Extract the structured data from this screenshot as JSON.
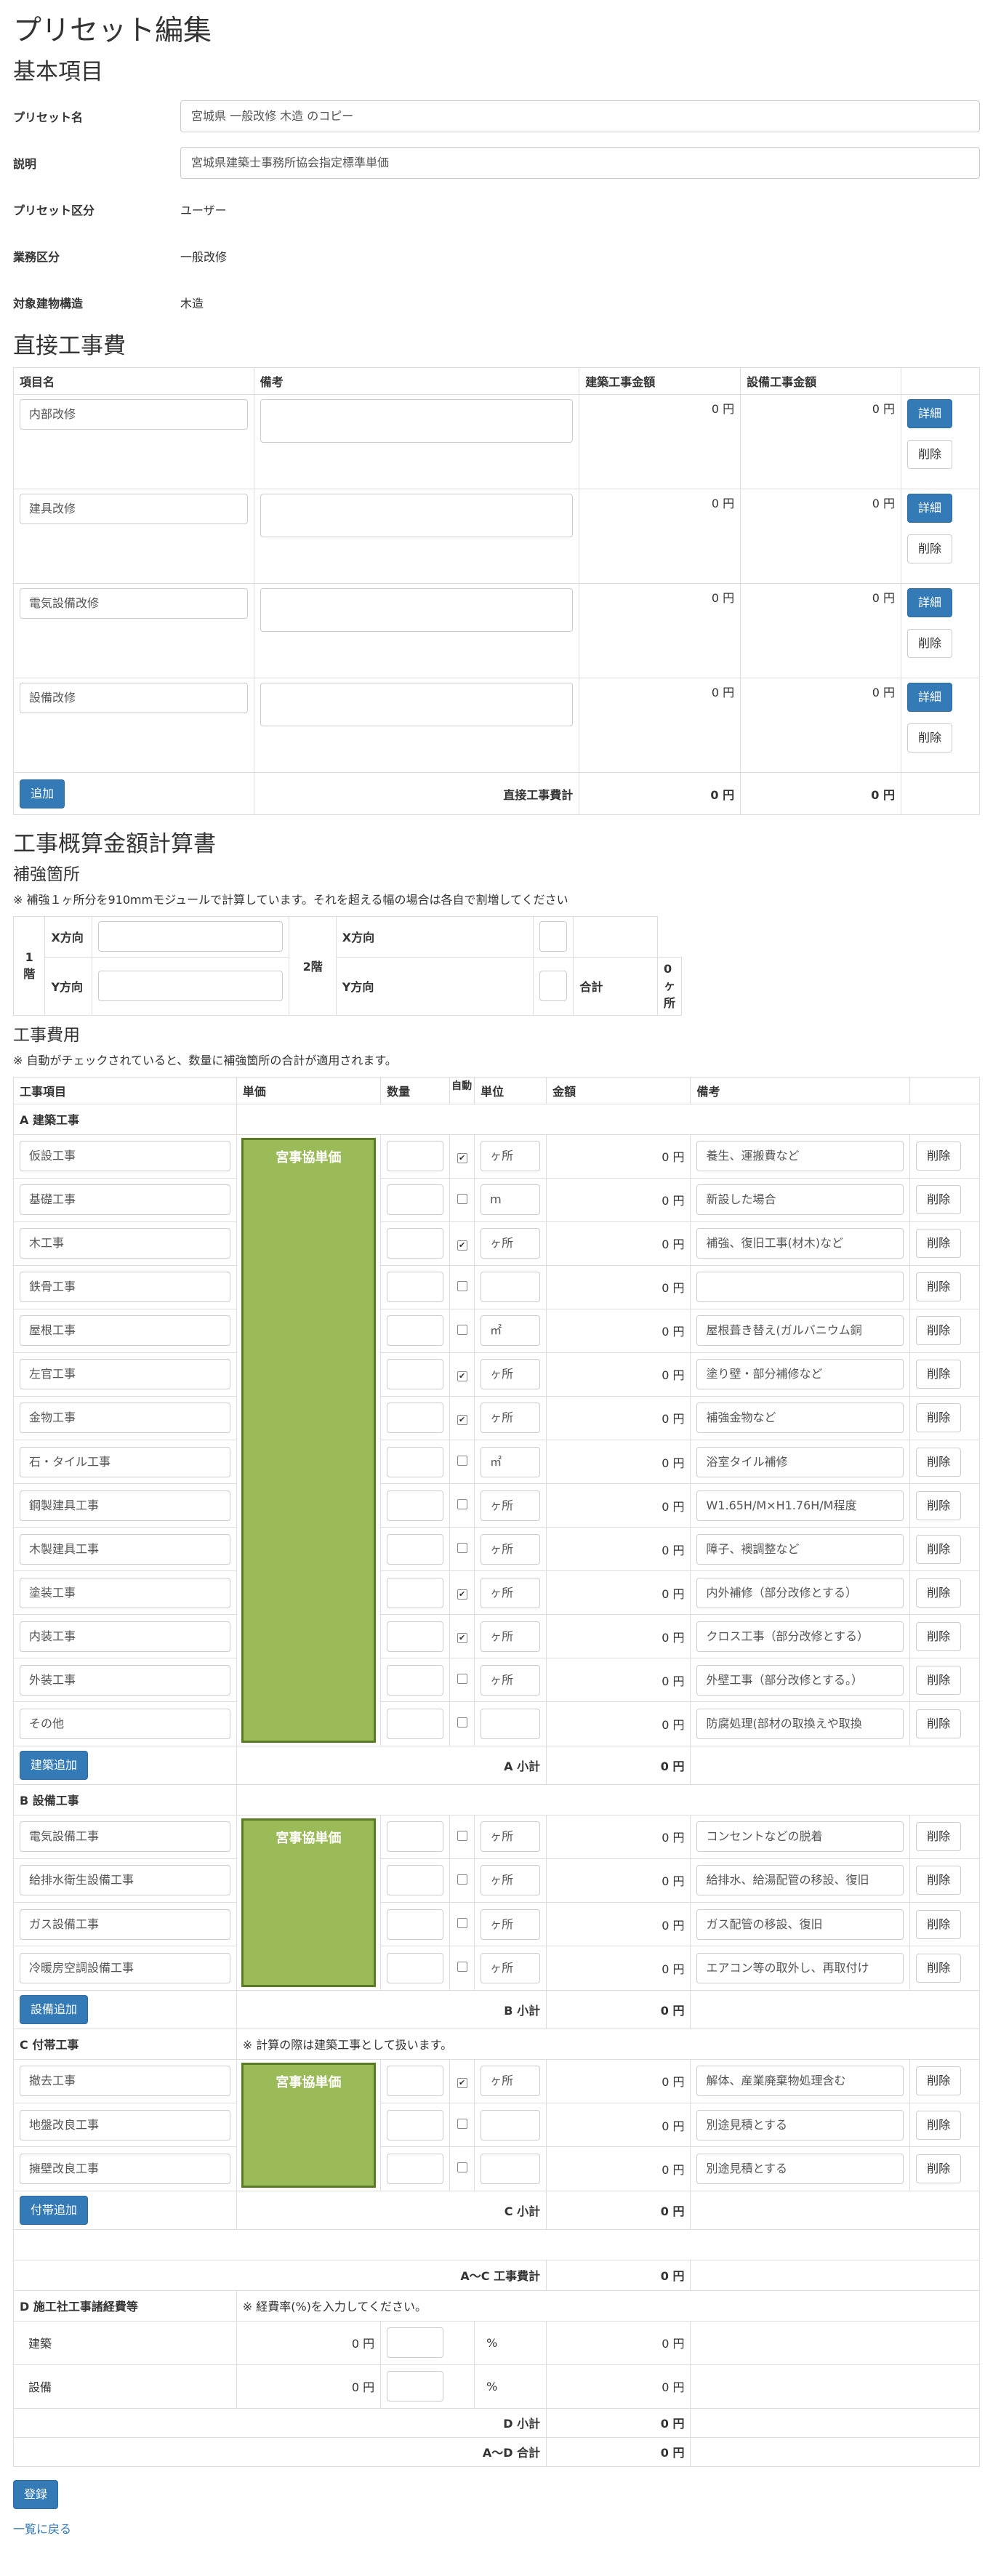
{
  "page_title": "プリセット編集",
  "basic": {
    "heading": "基本項目",
    "preset_name_label": "プリセット名",
    "preset_name_value": "宮城県 一般改修 木造 のコピー",
    "description_label": "説明",
    "description_value": "宮城県建築士事務所協会指定標準単価",
    "preset_class_label": "プリセット区分",
    "preset_class_value": "ユーザー",
    "business_class_label": "業務区分",
    "business_class_value": "一般改修",
    "structure_label": "対象建物構造",
    "structure_value": "木造"
  },
  "direct": {
    "heading": "直接工事費",
    "headers": [
      "項目名",
      "備考",
      "建築工事金額",
      "設備工事金額",
      ""
    ],
    "detail_label": "詳細",
    "delete_label": "削除",
    "rows": [
      {
        "name": "内部改修",
        "arch": "0 円",
        "equip": "0 円"
      },
      {
        "name": "建具改修",
        "arch": "0 円",
        "equip": "0 円"
      },
      {
        "name": "電気設備改修",
        "arch": "0 円",
        "equip": "0 円"
      },
      {
        "name": "設備改修",
        "arch": "0 円",
        "equip": "0 円"
      }
    ],
    "add_label": "追加",
    "total_label": "直接工事費計",
    "total_arch": "0 円",
    "total_equip": "0 円"
  },
  "estimate": {
    "heading": "工事概算金額計算書",
    "reinforce": {
      "heading": "補強箇所",
      "note": "※ 補強１ヶ所分を910mmモジュールで計算しています。それを超える幅の場合は各自で割増してください",
      "floor1": "1階",
      "floor2": "2階",
      "x_dir": "X方向",
      "y_dir": "Y方向",
      "total_label": "合計",
      "total_value": "0 ヶ所"
    },
    "costs": {
      "heading": "工事費用",
      "note": "※ 自動がチェックされていると、数量に補強箇所の合計が適用されます。",
      "headers": {
        "item": "工事項目",
        "unit_price": "単価",
        "qty": "数量",
        "auto": "自動",
        "unit": "単位",
        "amount": "金額",
        "remarks": "備考"
      },
      "price_box_label": "宮事協単価",
      "delete_label": "削除",
      "section_a": {
        "title": "A 建築工事",
        "rows": [
          {
            "name": "仮設工事",
            "auto": true,
            "unit": "ヶ所",
            "amount": "0 円",
            "remark": "養生、運搬費など"
          },
          {
            "name": "基礎工事",
            "auto": false,
            "unit": "m",
            "amount": "0 円",
            "remark": "新設した場合"
          },
          {
            "name": "木工事",
            "auto": true,
            "unit": "ヶ所",
            "amount": "0 円",
            "remark": "補強、復旧工事(材木)など"
          },
          {
            "name": "鉄骨工事",
            "auto": false,
            "unit": "",
            "amount": "0 円",
            "remark": ""
          },
          {
            "name": "屋根工事",
            "auto": false,
            "unit": "㎡",
            "amount": "0 円",
            "remark": "屋根葺き替え(ガルバニウム銅"
          },
          {
            "name": "左官工事",
            "auto": true,
            "unit": "ヶ所",
            "amount": "0 円",
            "remark": "塗り壁・部分補修など"
          },
          {
            "name": "金物工事",
            "auto": true,
            "unit": "ヶ所",
            "amount": "0 円",
            "remark": "補強金物など"
          },
          {
            "name": "石・タイル工事",
            "auto": false,
            "unit": "㎡",
            "amount": "0 円",
            "remark": "浴室タイル補修"
          },
          {
            "name": "鋼製建具工事",
            "auto": false,
            "unit": "ヶ所",
            "amount": "0 円",
            "remark": "W1.65H/M×H1.76H/M程度"
          },
          {
            "name": "木製建具工事",
            "auto": false,
            "unit": "ヶ所",
            "amount": "0 円",
            "remark": "障子、襖調整など"
          },
          {
            "name": "塗装工事",
            "auto": true,
            "unit": "ヶ所",
            "amount": "0 円",
            "remark": "内外補修（部分改修とする）"
          },
          {
            "name": "内装工事",
            "auto": true,
            "unit": "ヶ所",
            "amount": "0 円",
            "remark": "クロス工事（部分改修とする）"
          },
          {
            "name": "外装工事",
            "auto": false,
            "unit": "ヶ所",
            "amount": "0 円",
            "remark": "外壁工事（部分改修とする。）"
          },
          {
            "name": "その他",
            "auto": false,
            "unit": "",
            "amount": "0 円",
            "remark": "防腐処理(部材の取換えや取換"
          }
        ],
        "add_label": "建築追加",
        "subtotal_label": "A 小計",
        "subtotal_value": "0 円"
      },
      "section_b": {
        "title": "B 設備工事",
        "rows": [
          {
            "name": "電気設備工事",
            "auto": false,
            "unit": "ヶ所",
            "amount": "0 円",
            "remark": "コンセントなどの脱着"
          },
          {
            "name": "給排水衛生設備工事",
            "auto": false,
            "unit": "ヶ所",
            "amount": "0 円",
            "remark": "給排水、給湯配管の移設、復旧"
          },
          {
            "name": "ガス設備工事",
            "auto": false,
            "unit": "ヶ所",
            "amount": "0 円",
            "remark": "ガス配管の移設、復旧"
          },
          {
            "name": "冷暖房空調設備工事",
            "auto": false,
            "unit": "ヶ所",
            "amount": "0 円",
            "remark": "エアコン等の取外し、再取付け"
          }
        ],
        "add_label": "設備追加",
        "subtotal_label": "B 小計",
        "subtotal_value": "0 円"
      },
      "section_c": {
        "title": "C 付帯工事",
        "note": "※ 計算の際は建築工事として扱います。",
        "rows": [
          {
            "name": "撤去工事",
            "auto": true,
            "unit": "ヶ所",
            "amount": "0 円",
            "remark": "解体、産業廃棄物処理含む"
          },
          {
            "name": "地盤改良工事",
            "auto": false,
            "unit": "",
            "amount": "0 円",
            "remark": "別途見積とする"
          },
          {
            "name": "擁壁改良工事",
            "auto": false,
            "unit": "",
            "amount": "0 円",
            "remark": "別途見積とする"
          }
        ],
        "add_label": "付帯追加",
        "subtotal_label": "C 小計",
        "subtotal_value": "0 円"
      },
      "ac_total_label": "A～C 工事費計",
      "ac_total_value": "0 円",
      "section_d": {
        "title": "D 施工社工事諸経費等",
        "note": "※ 経費率(%)を入力してください。",
        "rows": [
          {
            "name": "建築",
            "base": "0 円",
            "pct": "%",
            "amount": "0 円"
          },
          {
            "name": "設備",
            "base": "0 円",
            "pct": "%",
            "amount": "0 円"
          }
        ],
        "subtotal_label": "D 小計",
        "subtotal_value": "0 円"
      },
      "ad_total_label": "A～D 合計",
      "ad_total_value": "0 円"
    }
  },
  "register_label": "登録",
  "back_link": "一覧に戻る",
  "colors": {
    "primary": "#337ab7",
    "price_box": "#9bbb59",
    "price_box_border": "#5a7a23"
  }
}
